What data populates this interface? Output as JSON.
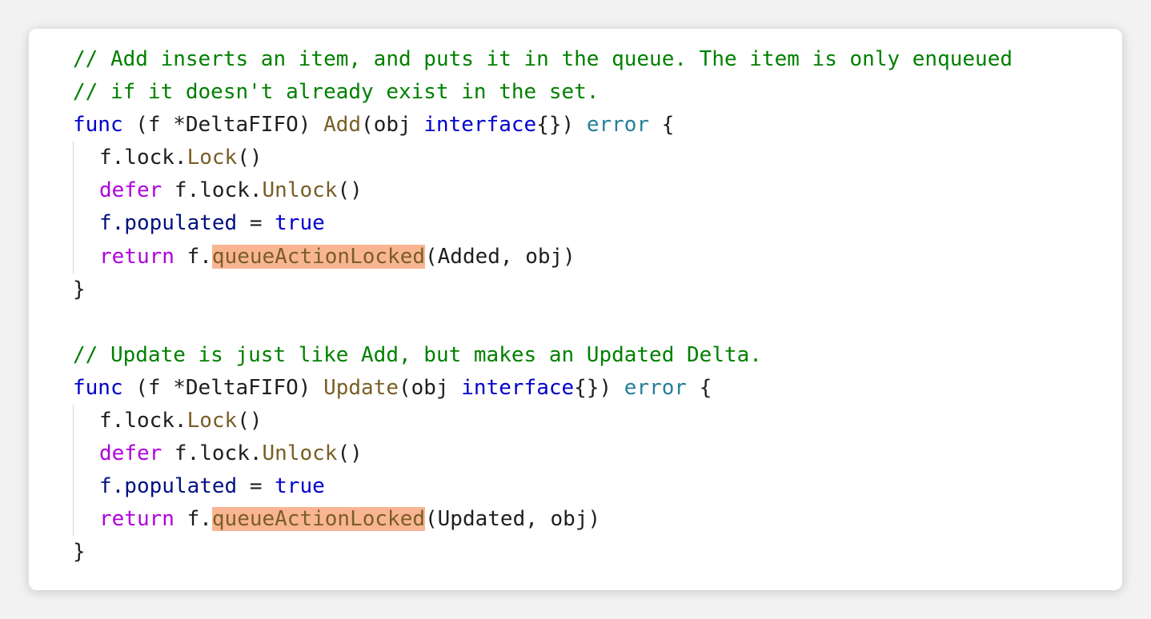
{
  "blocks": [
    {
      "comment_lines": [
        "// Add inserts an item, and puts it in the queue. The item is only enqueued",
        "// if it doesn't already exist in the set."
      ],
      "signature": {
        "func_kw": "func",
        "receiver": " (f *DeltaFIFO) ",
        "name": "Add",
        "params_open": "(obj ",
        "param_type": "interface",
        "params_close": "{}) ",
        "return_type": "error",
        "brace": " {"
      },
      "body": {
        "lock_prefix": "f.lock.",
        "lock_call": "Lock",
        "lock_suffix": "()",
        "defer_kw": "defer",
        "unlock_prefix": " f.lock.",
        "unlock_call": "Unlock",
        "unlock_suffix": "()",
        "populated_field": "f.populated",
        "assign": " = ",
        "true_kw": "true",
        "return_kw": "return",
        "queue_prefix": " f.",
        "queue_call": "queueActionLocked",
        "queue_args": "(Added, obj)"
      },
      "closing": "}"
    },
    {
      "comment_lines": [
        "// Update is just like Add, but makes an Updated Delta."
      ],
      "signature": {
        "func_kw": "func",
        "receiver": " (f *DeltaFIFO) ",
        "name": "Update",
        "params_open": "(obj ",
        "param_type": "interface",
        "params_close": "{}) ",
        "return_type": "error",
        "brace": " {"
      },
      "body": {
        "lock_prefix": "f.lock.",
        "lock_call": "Lock",
        "lock_suffix": "()",
        "defer_kw": "defer",
        "unlock_prefix": " f.lock.",
        "unlock_call": "Unlock",
        "unlock_suffix": "()",
        "populated_field": "f.populated",
        "assign": " = ",
        "true_kw": "true",
        "return_kw": "return",
        "queue_prefix": " f.",
        "queue_call": "queueActionLocked",
        "queue_args": "(Updated, obj)"
      },
      "closing": "}"
    }
  ],
  "colors": {
    "comment": "#008000",
    "keyword_blue": "#0000cc",
    "keyword_purple": "#af00db",
    "type": "#267f99",
    "function": "#795e26",
    "variable": "#001080",
    "highlight": "#f9b593"
  }
}
